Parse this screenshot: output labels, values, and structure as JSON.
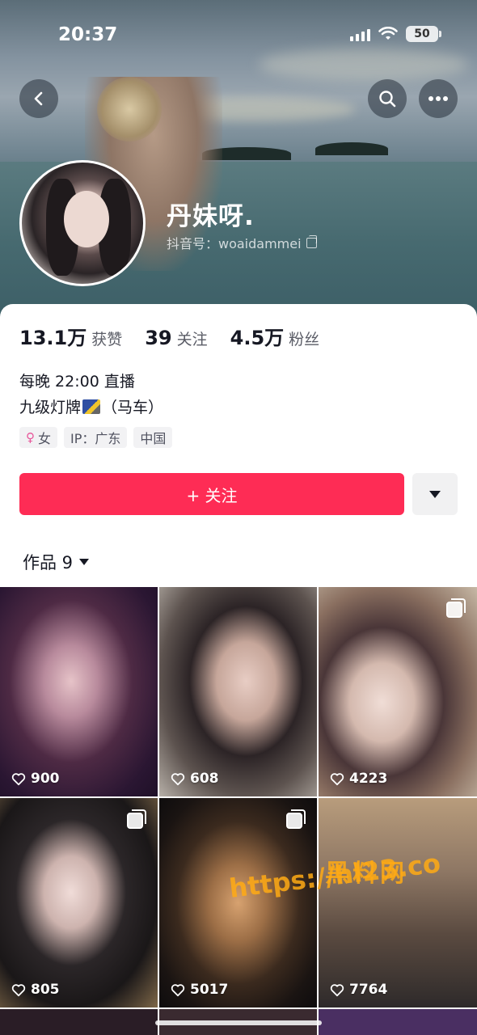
{
  "status_bar": {
    "time": "20:37",
    "battery": "50"
  },
  "profile": {
    "nickname": "丹妹呀.",
    "douyin_id": "抖音号：woaidammei",
    "stats": [
      {
        "value": "13.1万",
        "label": "获赞"
      },
      {
        "value": "39",
        "label": "关注"
      },
      {
        "value": "4.5万",
        "label": "粉丝"
      }
    ],
    "bio_line1": "每晚 22:00 直播",
    "bio_line2_prefix": "九级灯牌",
    "bio_line2_suffix": "（马车）",
    "tags": [
      {
        "icon": "female-icon",
        "label": "女"
      },
      {
        "label": "IP：广东"
      },
      {
        "label": "中国"
      }
    ],
    "follow_button": "+ 关注"
  },
  "works": {
    "tab_label": "作品 9",
    "items": [
      {
        "likes": "900",
        "multi": false
      },
      {
        "likes": "608",
        "multi": false
      },
      {
        "likes": "4223",
        "multi": true
      },
      {
        "likes": "805",
        "multi": true
      },
      {
        "likes": "5017",
        "multi": true
      },
      {
        "likes": "7764",
        "multi": false
      }
    ]
  },
  "watermark": {
    "line1": "黑料网",
    "line2": "https://hl23.co"
  },
  "colors": {
    "accent": "#fe2c55",
    "text": "#161823"
  }
}
